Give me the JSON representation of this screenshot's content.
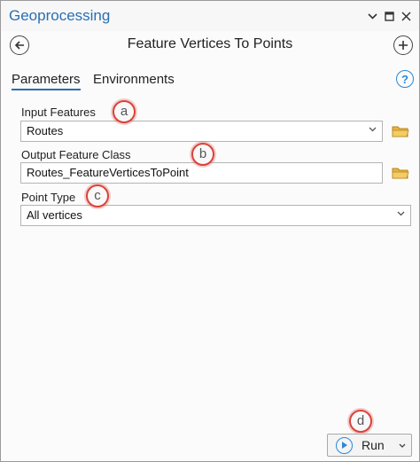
{
  "pane": {
    "title": "Geoprocessing",
    "pin_icon": "chevron-down-icon",
    "maximize_icon": "maximize-icon",
    "close_icon": "close-icon"
  },
  "tool": {
    "title": "Feature Vertices To Points",
    "back_icon": "back-arrow-icon",
    "add_icon": "add-icon"
  },
  "tabs": [
    {
      "label": "Parameters",
      "active": true
    },
    {
      "label": "Environments",
      "active": false
    }
  ],
  "help_icon": "help-icon",
  "parameters": {
    "input_features": {
      "label": "Input Features",
      "value": "Routes"
    },
    "output_feature_class": {
      "label": "Output Feature Class",
      "value": "Routes_FeatureVerticesToPoint"
    },
    "point_type": {
      "label": "Point Type",
      "value": "All vertices"
    }
  },
  "markers": [
    "a",
    "b",
    "c",
    "d"
  ],
  "run": {
    "label": "Run"
  },
  "colors": {
    "accent": "#2a6fb3",
    "marker": "#d9433a",
    "folder": "#e8b33d"
  }
}
